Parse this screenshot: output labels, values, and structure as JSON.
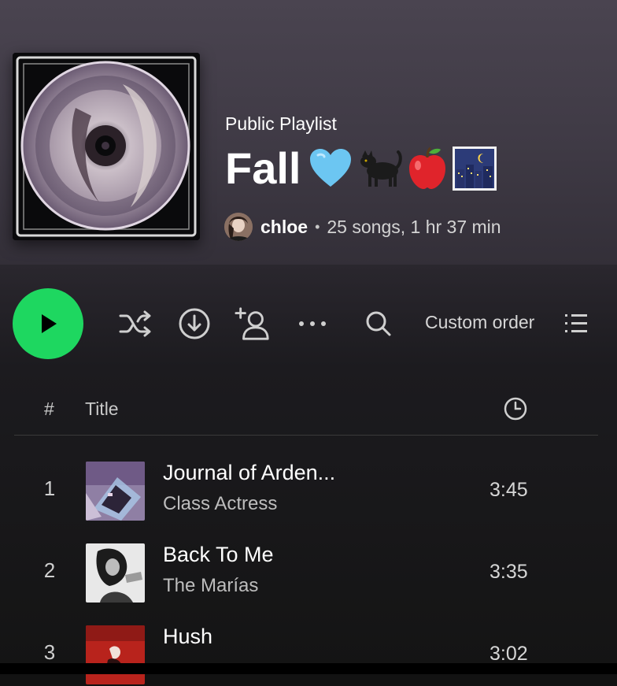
{
  "playlist": {
    "type_label": "Public Playlist",
    "title": "Fall",
    "title_emojis": [
      "light-blue-heart",
      "black-cat",
      "red-apple",
      "night-city"
    ],
    "owner": "chloe",
    "meta": "25 songs, 1 hr 37 min"
  },
  "controls": {
    "sort_label": "Custom order"
  },
  "table": {
    "num_header": "#",
    "title_header": "Title",
    "duration_header_icon": "clock-icon"
  },
  "tracks": [
    {
      "num": "1",
      "title": "Journal of Arden...",
      "artist": "Class Actress",
      "duration": "3:45"
    },
    {
      "num": "2",
      "title": "Back To Me",
      "artist": "The Marías",
      "duration": "3:35"
    },
    {
      "num": "3",
      "title": "Hush",
      "artist": "",
      "duration": "3:02"
    }
  ],
  "colors": {
    "accent_green": "#1ed760",
    "header_bg": "#4a4450",
    "page_bg": "#121212"
  }
}
